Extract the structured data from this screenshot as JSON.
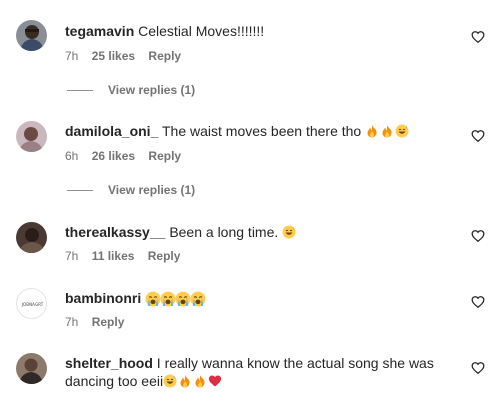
{
  "comments": [
    {
      "username": "tegamavin",
      "text": "Celestial Moves!!!!!!!",
      "emojis": [],
      "time": "7h",
      "likes": "25 likes",
      "reply": "Reply",
      "view_replies": "View replies (1)"
    },
    {
      "username": "damilola_oni_",
      "text": "The waist moves been there tho",
      "emojis": [
        "fire",
        "fire",
        "grin-sweat"
      ],
      "time": "6h",
      "likes": "26 likes",
      "reply": "Reply",
      "view_replies": "View replies (1)"
    },
    {
      "username": "therealkassy__",
      "text": "Been a long time.",
      "emojis": [
        "grin-sweat"
      ],
      "time": "7h",
      "likes": "11 likes",
      "reply": "Reply"
    },
    {
      "username": "bambinonri",
      "avatar_text": "JOBNAGRT",
      "text": "",
      "emojis": [
        "crying",
        "crying",
        "crying",
        "crying"
      ],
      "time": "7h",
      "likes": "",
      "reply": "Reply"
    },
    {
      "username": "shelter_hood",
      "text": "I really wanna know the actual song she was dancing too eeii",
      "emojis": [
        "grin-sweat",
        "fire",
        "fire",
        "red-heart"
      ],
      "time": "",
      "likes": "",
      "reply": ""
    }
  ],
  "icons": {
    "like": "heart-outline-icon",
    "fire": "fire-emoji",
    "grin_sweat": "grinning-sweat-emoji",
    "crying": "loudly-crying-emoji",
    "heart": "red-heart-emoji"
  },
  "colors": {
    "text": "#262626",
    "secondary": "#737373",
    "divider": "#8e8e8e"
  }
}
